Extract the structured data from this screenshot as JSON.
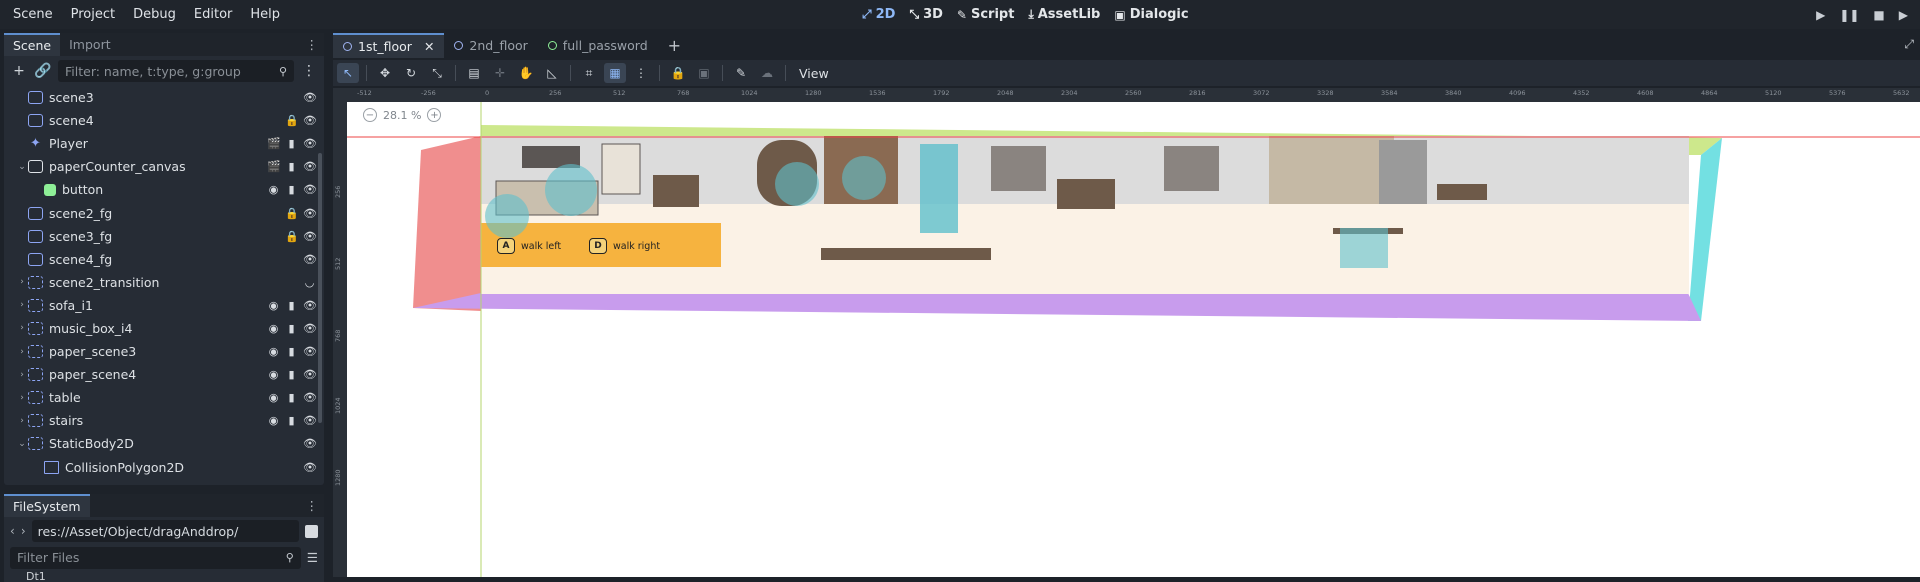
{
  "menu": [
    "Scene",
    "Project",
    "Debug",
    "Editor",
    "Help"
  ],
  "workspaces": [
    {
      "label": "2D",
      "icon": "2d-icon",
      "active": true
    },
    {
      "label": "3D",
      "icon": "3d-icon",
      "active": false
    },
    {
      "label": "Script",
      "icon": "script-icon",
      "active": false
    },
    {
      "label": "AssetLib",
      "icon": "assetlib-icon",
      "active": false
    },
    {
      "label": "Dialogic",
      "icon": "dialogic-icon",
      "active": false
    }
  ],
  "scene_dock": {
    "tabs": [
      "Scene",
      "Import"
    ],
    "filter_placeholder": "Filter: name, t:type, g:group",
    "nodes": [
      {
        "name": "scene3",
        "type": "node2d",
        "indent": 1,
        "arrow": "",
        "icons": [
          "eye"
        ]
      },
      {
        "name": "scene4",
        "type": "node2d",
        "indent": 1,
        "arrow": "",
        "icons": [
          "lock",
          "eye"
        ]
      },
      {
        "name": "Player",
        "type": "player",
        "indent": 1,
        "arrow": "",
        "icons": [
          "clapper",
          "script",
          "eye"
        ]
      },
      {
        "name": "paperCounter_canvas",
        "type": "canvas",
        "indent": 1,
        "arrow": "v",
        "icons": [
          "clapper",
          "script",
          "eye"
        ]
      },
      {
        "name": "button",
        "type": "button",
        "indent": 2,
        "arrow": "",
        "icons": [
          "signal",
          "script",
          "eye"
        ]
      },
      {
        "name": "scene2_fg",
        "type": "node2d",
        "indent": 1,
        "arrow": "",
        "icons": [
          "lock",
          "eye"
        ]
      },
      {
        "name": "scene3_fg",
        "type": "node2d",
        "indent": 1,
        "arrow": "",
        "icons": [
          "lock",
          "eye"
        ]
      },
      {
        "name": "scene4_fg",
        "type": "node2d",
        "indent": 1,
        "arrow": "",
        "icons": [
          "eye"
        ]
      },
      {
        "name": "scene2_transition",
        "type": "area",
        "indent": 1,
        "arrow": ">",
        "icons": [
          "hidden"
        ]
      },
      {
        "name": "sofa_i1",
        "type": "area",
        "indent": 1,
        "arrow": ">",
        "icons": [
          "signal",
          "script",
          "eye"
        ]
      },
      {
        "name": "music_box_i4",
        "type": "area",
        "indent": 1,
        "arrow": ">",
        "icons": [
          "signal",
          "script",
          "eye"
        ]
      },
      {
        "name": "paper_scene3",
        "type": "area",
        "indent": 1,
        "arrow": ">",
        "icons": [
          "signal",
          "script",
          "eye"
        ]
      },
      {
        "name": "paper_scene4",
        "type": "area",
        "indent": 1,
        "arrow": ">",
        "icons": [
          "signal",
          "script",
          "eye"
        ]
      },
      {
        "name": "table",
        "type": "area",
        "indent": 1,
        "arrow": ">",
        "icons": [
          "signal",
          "script",
          "eye"
        ]
      },
      {
        "name": "stairs",
        "type": "area",
        "indent": 1,
        "arrow": ">",
        "icons": [
          "signal",
          "script",
          "eye"
        ]
      },
      {
        "name": "StaticBody2D",
        "type": "area",
        "indent": 1,
        "arrow": "v",
        "icons": [
          "eye"
        ]
      },
      {
        "name": "CollisionPolygon2D",
        "type": "poly",
        "indent": 2,
        "arrow": "",
        "icons": [
          "eye"
        ]
      }
    ]
  },
  "filesystem": {
    "tab": "FileSystem",
    "path": "res://Asset/Object/dragAnddrop/",
    "filter_placeholder": "Filter Files",
    "partial_item": "Dt1"
  },
  "editor_tabs": [
    {
      "label": "1st_floor",
      "active": true,
      "color": "#9fb3f0"
    },
    {
      "label": "2nd_floor",
      "active": false,
      "color": "#9fb3f0"
    },
    {
      "label": "full_password",
      "active": false,
      "color": "#8eef97"
    }
  ],
  "toolbar": {
    "view_label": "View"
  },
  "viewport": {
    "zoom": "28.1 %",
    "ruler_ticks": [
      "-512",
      "-256",
      "0",
      "256",
      "512",
      "768",
      "1024",
      "1280",
      "1536",
      "1792",
      "2048",
      "2304",
      "2560",
      "2816",
      "3072",
      "3328",
      "3584",
      "3840",
      "4096",
      "4352",
      "4608",
      "4864",
      "5120",
      "5376",
      "5632"
    ],
    "ruler_left_ticks": [
      "256",
      "512",
      "768",
      "1024",
      "1280"
    ],
    "hints": [
      {
        "key": "A",
        "label": "walk left"
      },
      {
        "key": "D",
        "label": "walk right"
      }
    ]
  }
}
